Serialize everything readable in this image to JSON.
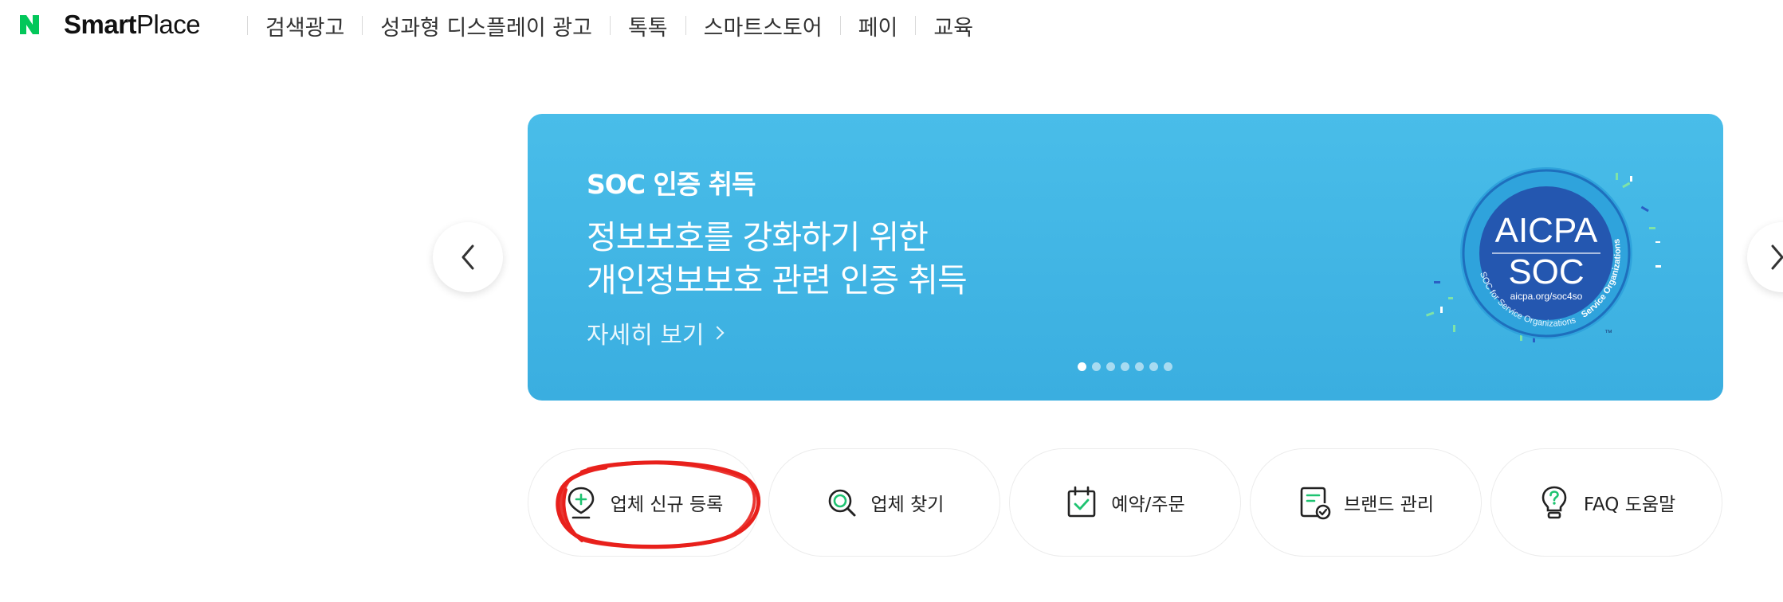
{
  "header": {
    "brand_bold": "Smart",
    "brand_light": "Place",
    "nav": [
      "검색광고",
      "성과형 디스플레이 광고",
      "톡톡",
      "스마트스토어",
      "페이",
      "교육"
    ]
  },
  "banner": {
    "subtitle": "SOC 인증 취득",
    "title_line1": "정보보호를 강화하기 위한",
    "title_line2": "개인정보보호 관련 인증 취득",
    "more_label": "자세히 보기",
    "badge": {
      "line1": "AICPA",
      "line2": "SOC",
      "url": "aicpa.org/soc4so",
      "ring_left": "SOC for Service Organizations",
      "ring_right": "Service Organizations",
      "tm": "™"
    },
    "slide_count": 7,
    "active_slide": 1
  },
  "quick_menu": [
    {
      "label": "업체 신규 등록",
      "icon": "location-add-icon"
    },
    {
      "label": "업체 찾기",
      "icon": "search-icon"
    },
    {
      "label": "예약/주문",
      "icon": "calendar-check-icon"
    },
    {
      "label": "브랜드 관리",
      "icon": "brand-doc-icon"
    },
    {
      "label": "FAQ 도움말",
      "icon": "lightbulb-question-icon"
    }
  ],
  "colors": {
    "naver_green": "#03c75a",
    "banner_blue": "#43b8e6",
    "annotation_red": "#e8201c",
    "icon_green": "#1ec371"
  }
}
